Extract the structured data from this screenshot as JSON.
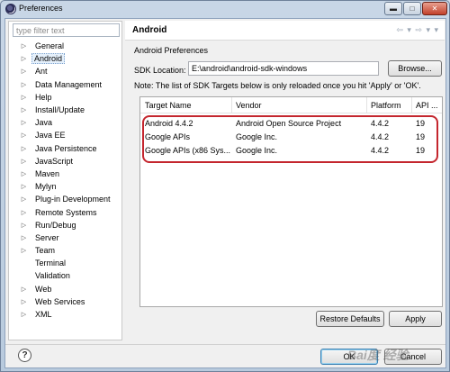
{
  "window": {
    "title": "Preferences",
    "minimize": "▬",
    "maximize": "□",
    "close": "✕"
  },
  "filter": {
    "placeholder": "type filter text"
  },
  "tree": [
    {
      "label": "General",
      "expandable": true
    },
    {
      "label": "Android",
      "expandable": true,
      "selected": true
    },
    {
      "label": "Ant",
      "expandable": true
    },
    {
      "label": "Data Management",
      "expandable": true
    },
    {
      "label": "Help",
      "expandable": true
    },
    {
      "label": "Install/Update",
      "expandable": true
    },
    {
      "label": "Java",
      "expandable": true
    },
    {
      "label": "Java EE",
      "expandable": true
    },
    {
      "label": "Java Persistence",
      "expandable": true
    },
    {
      "label": "JavaScript",
      "expandable": true
    },
    {
      "label": "Maven",
      "expandable": true
    },
    {
      "label": "Mylyn",
      "expandable": true
    },
    {
      "label": "Plug-in Development",
      "expandable": true
    },
    {
      "label": "Remote Systems",
      "expandable": true
    },
    {
      "label": "Run/Debug",
      "expandable": true
    },
    {
      "label": "Server",
      "expandable": true
    },
    {
      "label": "Team",
      "expandable": true
    },
    {
      "label": "Terminal",
      "expandable": false
    },
    {
      "label": "Validation",
      "expandable": false
    },
    {
      "label": "Web",
      "expandable": true
    },
    {
      "label": "Web Services",
      "expandable": true
    },
    {
      "label": "XML",
      "expandable": true
    }
  ],
  "page": {
    "title": "Android",
    "nav_arrows": "⇦ ▾ ⇨ ▾ ▾",
    "subtitle": "Android Preferences",
    "sdk_label": "SDK Location:",
    "sdk_value": "E:\\android\\android-sdk-windows",
    "browse_label": "Browse...",
    "note": "Note: The list of SDK Targets below is only reloaded once you hit 'Apply' or 'OK'."
  },
  "table": {
    "headers": [
      "Target Name",
      "Vendor",
      "Platform",
      "API ..."
    ],
    "rows": [
      [
        "Android 4.4.2",
        "Android Open Source Project",
        "4.4.2",
        "19"
      ],
      [
        "Google APIs",
        "Google Inc.",
        "4.4.2",
        "19"
      ],
      [
        "Google APIs (x86 Sys...",
        "Google Inc.",
        "4.4.2",
        "19"
      ]
    ]
  },
  "buttons": {
    "restore_defaults": "Restore Defaults",
    "apply": "Apply",
    "ok": "OK",
    "cancel": "Cancel",
    "help": "?"
  },
  "watermark": "Bai度 经验",
  "colors": {
    "highlight_border": "#c4262e",
    "selection_bg": "#e5f0fb"
  }
}
